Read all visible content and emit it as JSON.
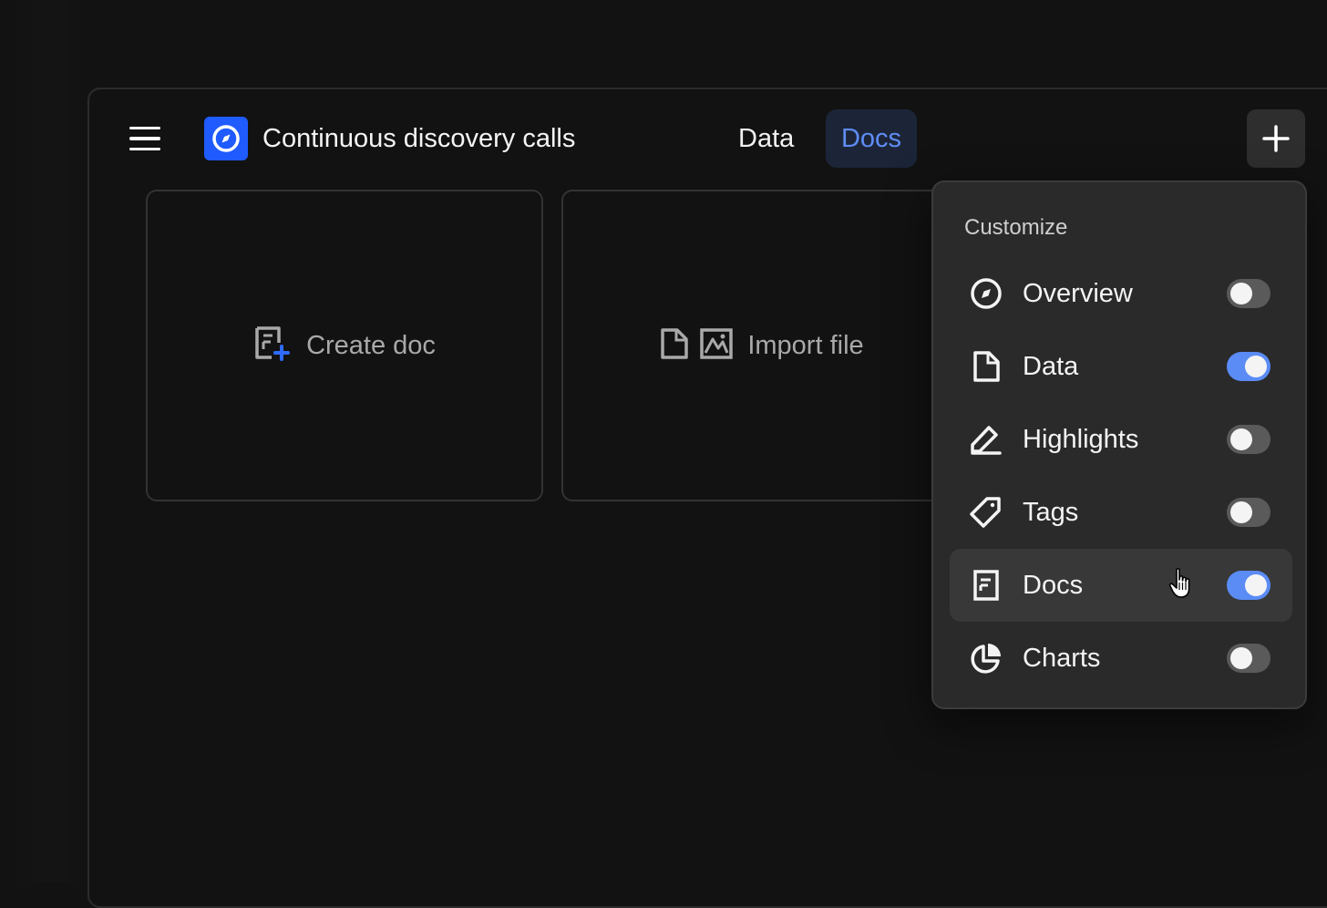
{
  "header": {
    "menu_icon": "hamburger-menu-icon",
    "project_icon": "compass-icon",
    "project_title": "Continuous discovery calls",
    "tabs": [
      {
        "label": "Data",
        "active": false
      },
      {
        "label": "Docs",
        "active": true
      }
    ],
    "add_icon": "plus-icon"
  },
  "cards": {
    "create": {
      "label": "Create doc",
      "icon": "doc-plus-icon"
    },
    "import": {
      "label": "Import file",
      "icons": [
        "file-icon",
        "image-icon"
      ]
    }
  },
  "customize_menu": {
    "heading": "Customize",
    "items": [
      {
        "label": "Overview",
        "icon": "compass-icon",
        "enabled": false
      },
      {
        "label": "Data",
        "icon": "file-icon",
        "enabled": true
      },
      {
        "label": "Highlights",
        "icon": "highlighter-icon",
        "enabled": false
      },
      {
        "label": "Tags",
        "icon": "tag-icon",
        "enabled": false
      },
      {
        "label": "Docs",
        "icon": "document-icon",
        "enabled": true,
        "hovered": true
      },
      {
        "label": "Charts",
        "icon": "pie-chart-icon",
        "enabled": false
      }
    ]
  },
  "colors": {
    "background": "#121212",
    "accent_blue": "#1f5bff",
    "toggle_on": "#5b8cf5",
    "active_tab_text": "#5f8df5"
  }
}
